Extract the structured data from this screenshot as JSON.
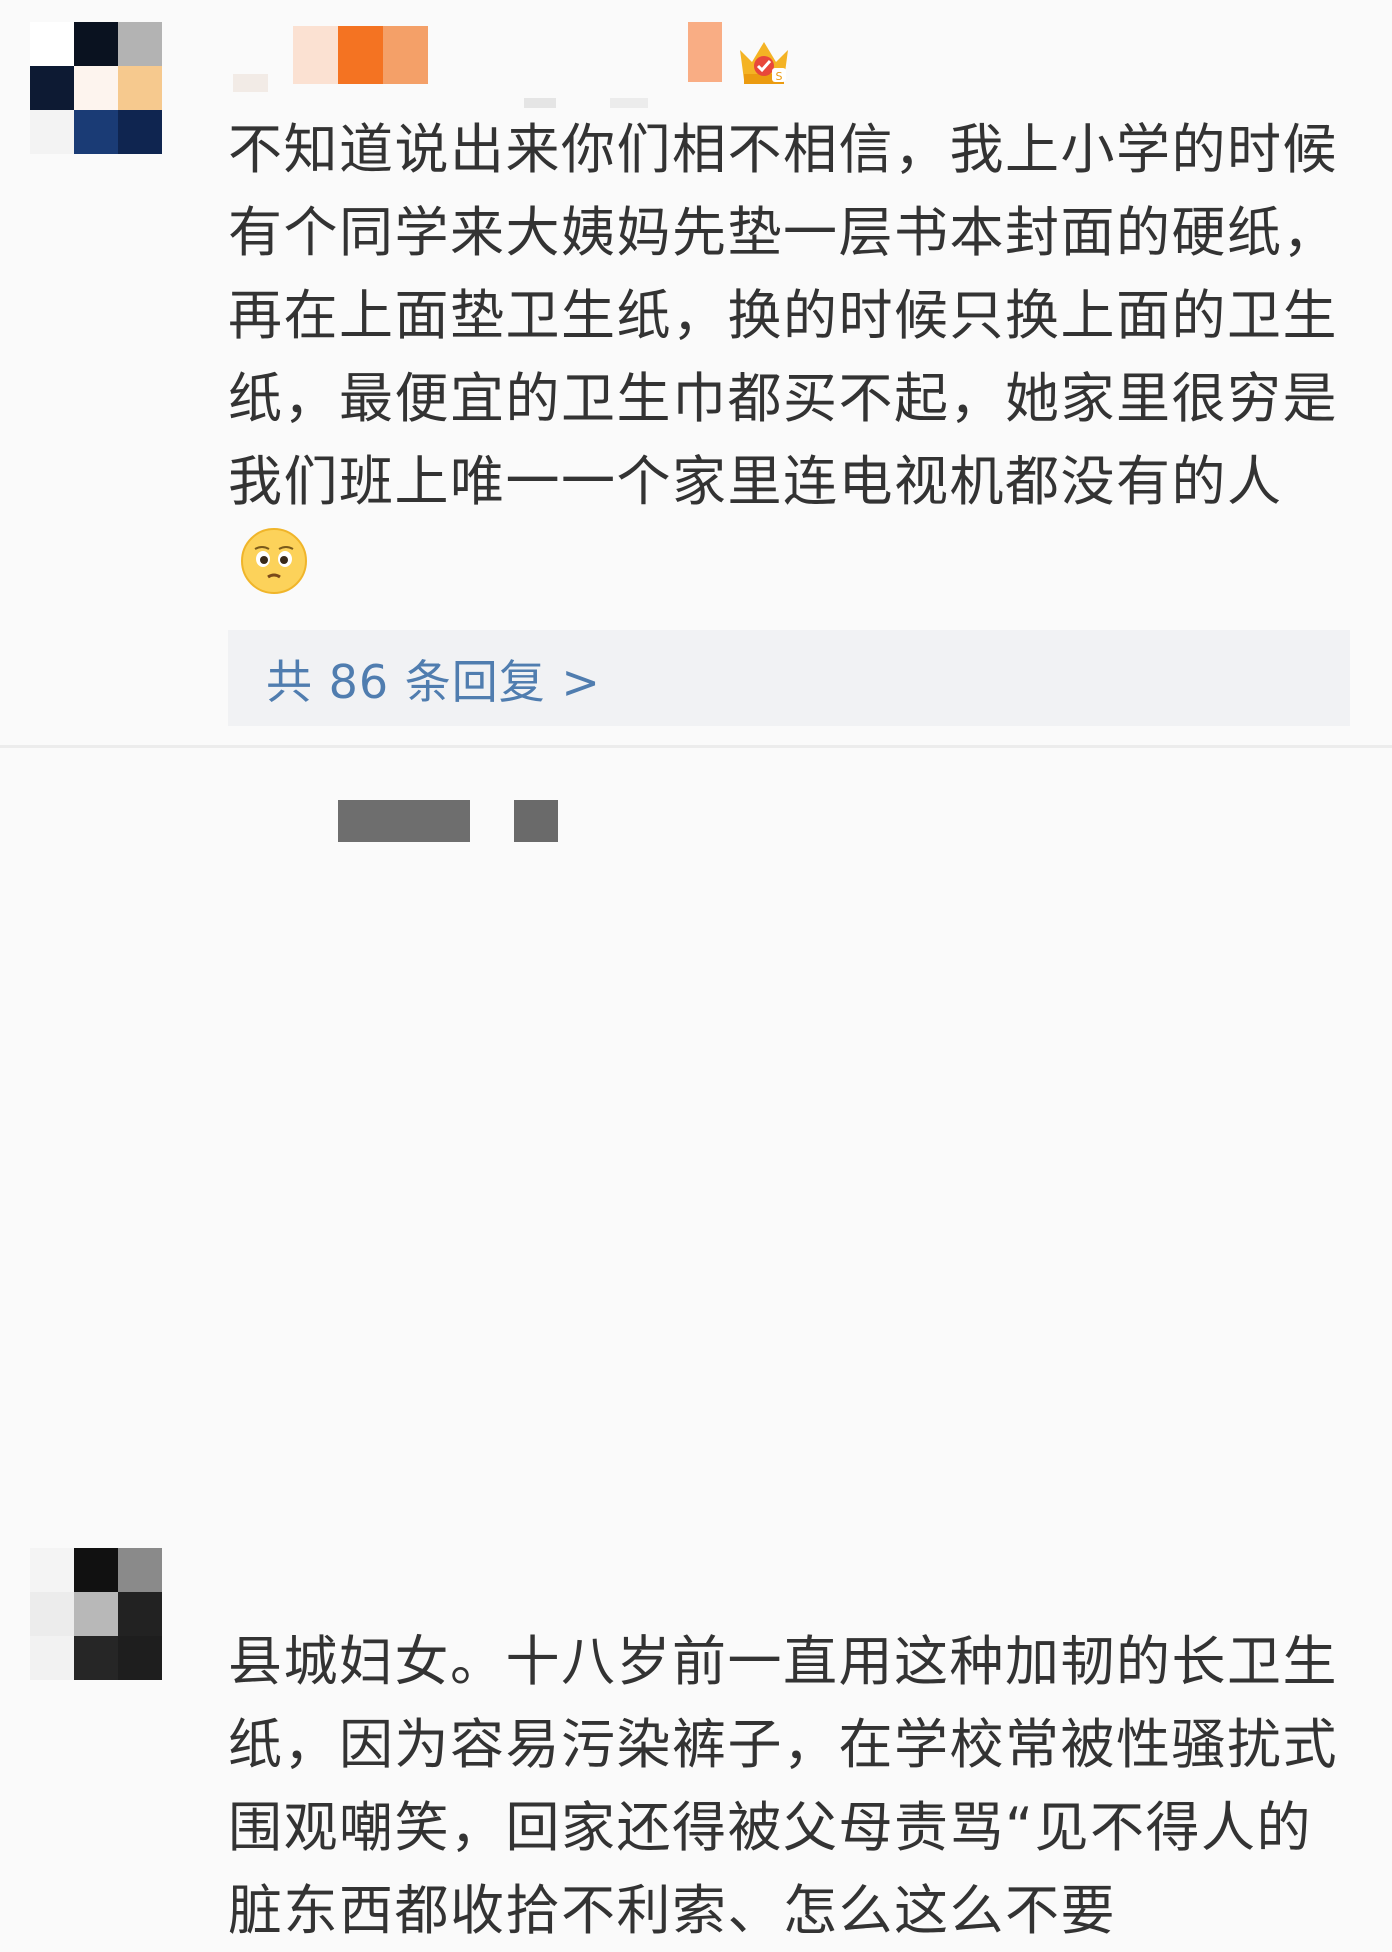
{
  "comments": [
    {
      "avatar_icon": "pixelated-avatar-icon",
      "badge_icon": "crown-icon",
      "text": "不知道说出来你们相不相信，我上小学的时候有个同学来大姨妈先垫一层书本封面的硬纸，再在上面垫卫生纸，换的时候只换上面的卫生纸，最便宜的卫生巾都买不起，她家里很穷是我们班上唯一一个家里连电视机都没有的人",
      "emoji_icon": "pleading-face-emoji-icon",
      "reply_link": "共 86 条回复 >"
    },
    {
      "avatar_icon": "pixelated-avatar-icon",
      "text": "县城妇女。十八岁前一直用这种加韧的长卫生纸，因为容易污染裤子，在学校常被性骚扰式围观嘲笑，回家还得被父母责骂“见不得人的脏东西都收拾不利索、怎么这么不要"
    }
  ],
  "colors": {
    "text": "#333333",
    "link": "#507daf",
    "reply_bg": "#f1f2f4",
    "page_bg": "#fafafa"
  }
}
